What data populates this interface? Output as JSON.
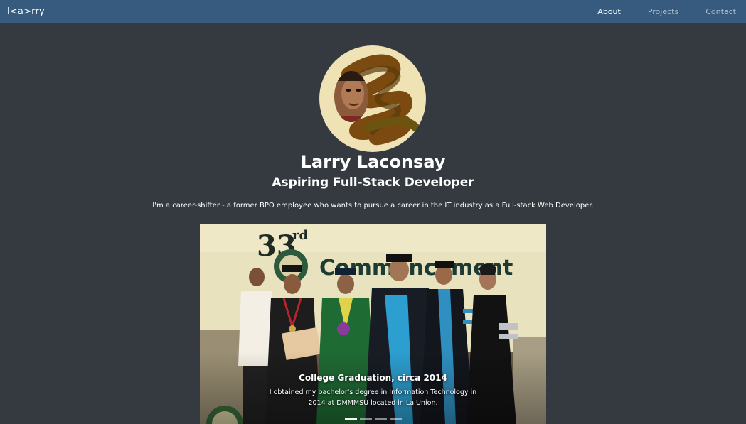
{
  "navbar": {
    "brand": "l<a>rry",
    "links": [
      {
        "label": "About",
        "active": true
      },
      {
        "label": "Projects",
        "active": false
      },
      {
        "label": "Contact",
        "active": false
      }
    ]
  },
  "profile": {
    "name": "Larry Laconsay",
    "title": "Aspiring Full-Stack Developer",
    "bio": "I'm a career-shifter - a former BPO employee who wants to pursue a career in the IT industry as a Full-stack Web Developer."
  },
  "carousel": {
    "active_index": 0,
    "slide_count": 4,
    "slides": [
      {
        "caption_title": "College Graduation, circa 2014",
        "caption_text": "I obtained my bachelor's degree in Information Technology in 2014 at DMMMSU located in La Union.",
        "photo_banner": "33rd Commencement"
      }
    ]
  },
  "colors": {
    "navbar": "#375a7f",
    "background": "#343a40",
    "avatar_bg": "#efe2b4"
  }
}
